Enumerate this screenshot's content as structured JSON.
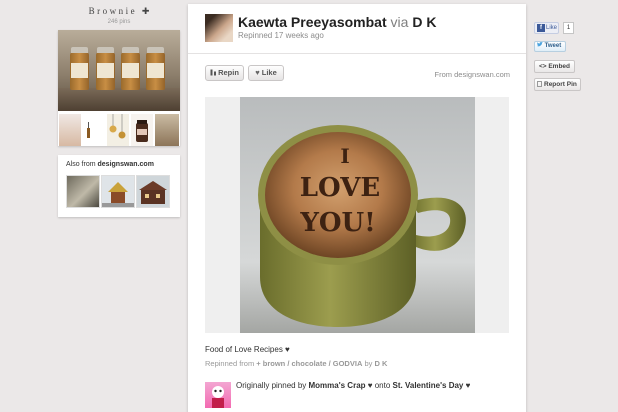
{
  "board": {
    "title": "Brownie",
    "title_icon": "✚",
    "pin_count": "246 pins"
  },
  "also_from": {
    "prefix": "Also from",
    "source": "designswan.com"
  },
  "pin": {
    "pinner_name": "Kaewta Preeyasombat",
    "via_word": "via",
    "via_user": "D K",
    "repinned_time": "Repinned 17 weeks ago",
    "repin_label": "Repin",
    "like_label": "Like",
    "from_source": "From designswan.com",
    "description": "Food of Love Recipes ♥",
    "repinned_from_prefix": "Repinned from",
    "repinned_from_board": "+ brown / chocolate / GODVIA",
    "repinned_from_by": "by",
    "repinned_from_user": "D K",
    "photo_text": [
      "I",
      "LOVE",
      "YOU!"
    ]
  },
  "original": {
    "prefix": "Originally pinned by",
    "user": "Momma's Crap ♥",
    "onto": "onto",
    "board": "St. Valentine's Day ♥"
  },
  "sidebar": {
    "fb_like_label": "Like",
    "fb_count": "1",
    "tweet_label": "Tweet",
    "embed_label": "<> Embed",
    "report_label": "Report Pin"
  },
  "colors": {
    "background": "#ebe8e8",
    "link_text": "#222222",
    "muted_text": "#8c8c8c",
    "facebook_blue": "#3b5998",
    "twitter_blue": "#2c5d8a"
  },
  "icons": [
    "repin-icon",
    "heart-icon",
    "facebook-icon",
    "twitter-icon",
    "flag-icon",
    "cross-icon"
  ]
}
